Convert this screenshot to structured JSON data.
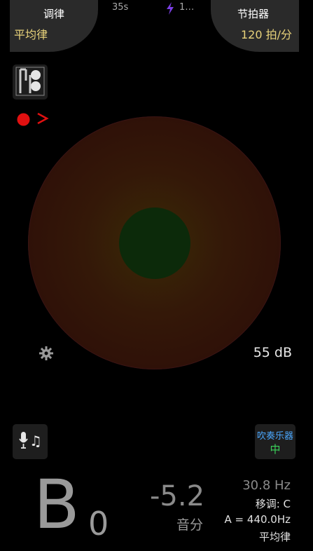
{
  "tuner_tab": {
    "title": "调律",
    "value": "平均律"
  },
  "metronome_tab": {
    "title": "节拍器",
    "value": "120 拍/分"
  },
  "status": {
    "timer": "35s",
    "power_text": "1…"
  },
  "level": {
    "db": "55 dB"
  },
  "reading": {
    "note": "B",
    "octave": "0",
    "cents": "-5.2",
    "cents_unit": "音分",
    "frequency": "30.8 Hz",
    "transpose": "移调: C",
    "reference": "A = 440.0Hz",
    "temperament": "平均律"
  },
  "instrument": {
    "type": "吹奏乐器",
    "level": "中"
  },
  "colors": {
    "accent_yellow": "#e8d27a",
    "record_red": "#e01010",
    "power_purple": "#7b3fe4",
    "wind_blue": "#4aa8ff",
    "wind_green": "#3ad25a"
  },
  "icons": [
    "instrument-icon",
    "record-icon",
    "chevron-right-icon",
    "gear-icon",
    "mic-note-icon",
    "lightning-icon"
  ]
}
